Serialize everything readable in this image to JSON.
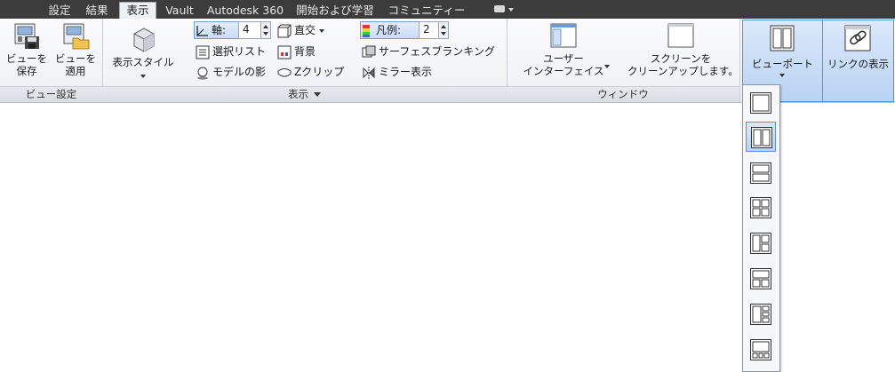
{
  "tabs": [
    {
      "label": "設定",
      "active": false
    },
    {
      "label": "結果",
      "active": false
    },
    {
      "label": "表示",
      "active": true
    },
    {
      "label": "Vault",
      "active": false
    },
    {
      "label": "Autodesk 360",
      "active": false
    },
    {
      "label": "開始および学習",
      "active": false
    },
    {
      "label": "コミュニティー",
      "active": false
    }
  ],
  "panels": {
    "view_settings": {
      "title": "ビュー設定",
      "save_view": {
        "line1": "ビューを",
        "line2": "保存"
      },
      "apply_view": {
        "line1": "ビューを",
        "line2": "適用"
      }
    },
    "display": {
      "title": "表示",
      "display_style": {
        "label": "表示スタイル"
      },
      "axis": {
        "label": "軸:",
        "value": "4"
      },
      "ortho": {
        "label": "直交"
      },
      "selection_list": {
        "label": "選択リスト"
      },
      "background": {
        "label": "背景"
      },
      "model_shadow": {
        "label": "モデルの影"
      },
      "z_clip": {
        "label": "Zクリップ"
      },
      "legend": {
        "label": "凡例:",
        "value": "2"
      },
      "surface_blanking": {
        "label": "サーフェスブランキング"
      },
      "mirror_display": {
        "label": "ミラー表示"
      }
    },
    "window": {
      "title": "ウィンドウ",
      "user_interface": {
        "line1": "ユーザー",
        "line2": "インターフェイス"
      },
      "clean_screen": {
        "line1": "スクリーンを",
        "line2": "クリーンアップします。"
      },
      "viewport": {
        "label": "ビューポート"
      },
      "link_display": {
        "label": "リンクの表示"
      }
    }
  },
  "viewport_layouts": [
    {
      "name": "single"
    },
    {
      "name": "two-vertical",
      "selected": true
    },
    {
      "name": "two-horizontal"
    },
    {
      "name": "four"
    },
    {
      "name": "three-left-big"
    },
    {
      "name": "three-top-big"
    },
    {
      "name": "four-left-big"
    },
    {
      "name": "four-bottom-small"
    }
  ],
  "colors": {
    "accent": "#5b8fd6",
    "tabbar": "#3c3c3c"
  }
}
